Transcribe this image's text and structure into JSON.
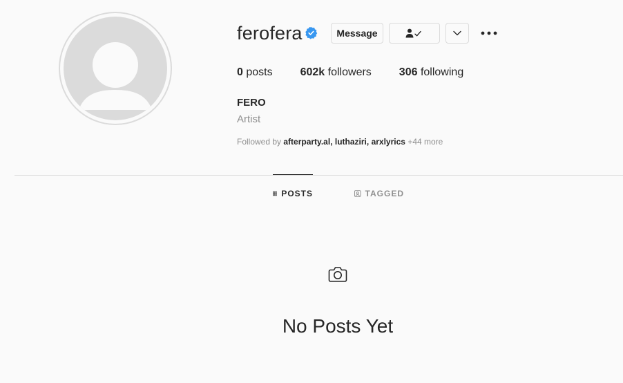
{
  "profile": {
    "username": "ferofera",
    "verified": true,
    "full_name": "FERO",
    "category": "Artist"
  },
  "actions": {
    "message_label": "Message",
    "following_icon": "person-check-icon",
    "suggest_icon": "chevron-down-icon",
    "more_icon": "more-dots-icon"
  },
  "stats": {
    "posts_count": "0",
    "posts_label": "posts",
    "followers_count": "602k",
    "followers_label": "followers",
    "following_count": "306",
    "following_label": "following"
  },
  "followed_by": {
    "prefix": "Followed by",
    "accounts": [
      "afterparty.al",
      "luthaziri",
      "arxlyrics"
    ],
    "separator": ",",
    "more": "+44 more"
  },
  "tabs": [
    {
      "label": "POSTS",
      "icon": "grid-icon",
      "active": true
    },
    {
      "label": "TAGGED",
      "icon": "tagged-icon",
      "active": false
    }
  ],
  "empty_state": {
    "icon": "camera-icon",
    "title": "No Posts Yet"
  },
  "colors": {
    "background": "#fafafa",
    "text": "#262626",
    "muted": "#8e8e8e",
    "border": "#dbdbdb",
    "verified_blue": "#3897f0"
  }
}
